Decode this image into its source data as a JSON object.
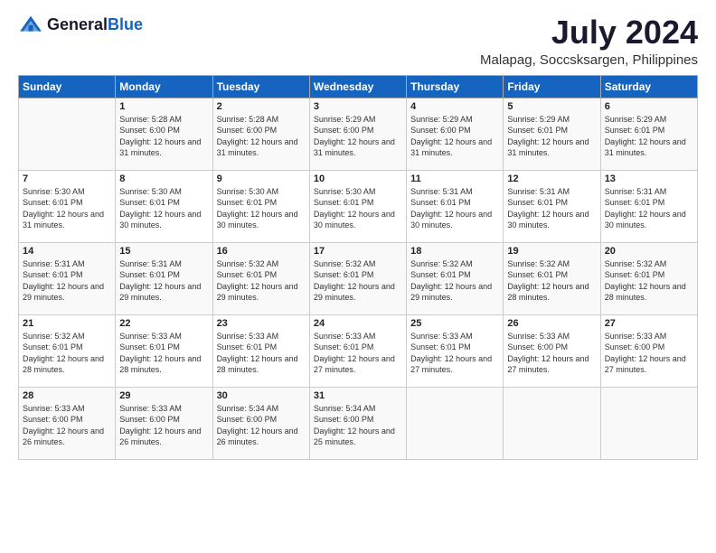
{
  "logo": {
    "general": "General",
    "blue": "Blue"
  },
  "title": "July 2024",
  "location": "Malapag, Soccsksargen, Philippines",
  "days_of_week": [
    "Sunday",
    "Monday",
    "Tuesday",
    "Wednesday",
    "Thursday",
    "Friday",
    "Saturday"
  ],
  "weeks": [
    [
      {
        "day": "",
        "info": ""
      },
      {
        "day": "1",
        "info": "Sunrise: 5:28 AM\nSunset: 6:00 PM\nDaylight: 12 hours and 31 minutes."
      },
      {
        "day": "2",
        "info": "Sunrise: 5:28 AM\nSunset: 6:00 PM\nDaylight: 12 hours and 31 minutes."
      },
      {
        "day": "3",
        "info": "Sunrise: 5:29 AM\nSunset: 6:00 PM\nDaylight: 12 hours and 31 minutes."
      },
      {
        "day": "4",
        "info": "Sunrise: 5:29 AM\nSunset: 6:00 PM\nDaylight: 12 hours and 31 minutes."
      },
      {
        "day": "5",
        "info": "Sunrise: 5:29 AM\nSunset: 6:01 PM\nDaylight: 12 hours and 31 minutes."
      },
      {
        "day": "6",
        "info": "Sunrise: 5:29 AM\nSunset: 6:01 PM\nDaylight: 12 hours and 31 minutes."
      }
    ],
    [
      {
        "day": "7",
        "info": "Sunrise: 5:30 AM\nSunset: 6:01 PM\nDaylight: 12 hours and 31 minutes."
      },
      {
        "day": "8",
        "info": "Sunrise: 5:30 AM\nSunset: 6:01 PM\nDaylight: 12 hours and 30 minutes."
      },
      {
        "day": "9",
        "info": "Sunrise: 5:30 AM\nSunset: 6:01 PM\nDaylight: 12 hours and 30 minutes."
      },
      {
        "day": "10",
        "info": "Sunrise: 5:30 AM\nSunset: 6:01 PM\nDaylight: 12 hours and 30 minutes."
      },
      {
        "day": "11",
        "info": "Sunrise: 5:31 AM\nSunset: 6:01 PM\nDaylight: 12 hours and 30 minutes."
      },
      {
        "day": "12",
        "info": "Sunrise: 5:31 AM\nSunset: 6:01 PM\nDaylight: 12 hours and 30 minutes."
      },
      {
        "day": "13",
        "info": "Sunrise: 5:31 AM\nSunset: 6:01 PM\nDaylight: 12 hours and 30 minutes."
      }
    ],
    [
      {
        "day": "14",
        "info": "Sunrise: 5:31 AM\nSunset: 6:01 PM\nDaylight: 12 hours and 29 minutes."
      },
      {
        "day": "15",
        "info": "Sunrise: 5:31 AM\nSunset: 6:01 PM\nDaylight: 12 hours and 29 minutes."
      },
      {
        "day": "16",
        "info": "Sunrise: 5:32 AM\nSunset: 6:01 PM\nDaylight: 12 hours and 29 minutes."
      },
      {
        "day": "17",
        "info": "Sunrise: 5:32 AM\nSunset: 6:01 PM\nDaylight: 12 hours and 29 minutes."
      },
      {
        "day": "18",
        "info": "Sunrise: 5:32 AM\nSunset: 6:01 PM\nDaylight: 12 hours and 29 minutes."
      },
      {
        "day": "19",
        "info": "Sunrise: 5:32 AM\nSunset: 6:01 PM\nDaylight: 12 hours and 28 minutes."
      },
      {
        "day": "20",
        "info": "Sunrise: 5:32 AM\nSunset: 6:01 PM\nDaylight: 12 hours and 28 minutes."
      }
    ],
    [
      {
        "day": "21",
        "info": "Sunrise: 5:32 AM\nSunset: 6:01 PM\nDaylight: 12 hours and 28 minutes."
      },
      {
        "day": "22",
        "info": "Sunrise: 5:33 AM\nSunset: 6:01 PM\nDaylight: 12 hours and 28 minutes."
      },
      {
        "day": "23",
        "info": "Sunrise: 5:33 AM\nSunset: 6:01 PM\nDaylight: 12 hours and 28 minutes."
      },
      {
        "day": "24",
        "info": "Sunrise: 5:33 AM\nSunset: 6:01 PM\nDaylight: 12 hours and 27 minutes."
      },
      {
        "day": "25",
        "info": "Sunrise: 5:33 AM\nSunset: 6:01 PM\nDaylight: 12 hours and 27 minutes."
      },
      {
        "day": "26",
        "info": "Sunrise: 5:33 AM\nSunset: 6:00 PM\nDaylight: 12 hours and 27 minutes."
      },
      {
        "day": "27",
        "info": "Sunrise: 5:33 AM\nSunset: 6:00 PM\nDaylight: 12 hours and 27 minutes."
      }
    ],
    [
      {
        "day": "28",
        "info": "Sunrise: 5:33 AM\nSunset: 6:00 PM\nDaylight: 12 hours and 26 minutes."
      },
      {
        "day": "29",
        "info": "Sunrise: 5:33 AM\nSunset: 6:00 PM\nDaylight: 12 hours and 26 minutes."
      },
      {
        "day": "30",
        "info": "Sunrise: 5:34 AM\nSunset: 6:00 PM\nDaylight: 12 hours and 26 minutes."
      },
      {
        "day": "31",
        "info": "Sunrise: 5:34 AM\nSunset: 6:00 PM\nDaylight: 12 hours and 25 minutes."
      },
      {
        "day": "",
        "info": ""
      },
      {
        "day": "",
        "info": ""
      },
      {
        "day": "",
        "info": ""
      }
    ]
  ]
}
